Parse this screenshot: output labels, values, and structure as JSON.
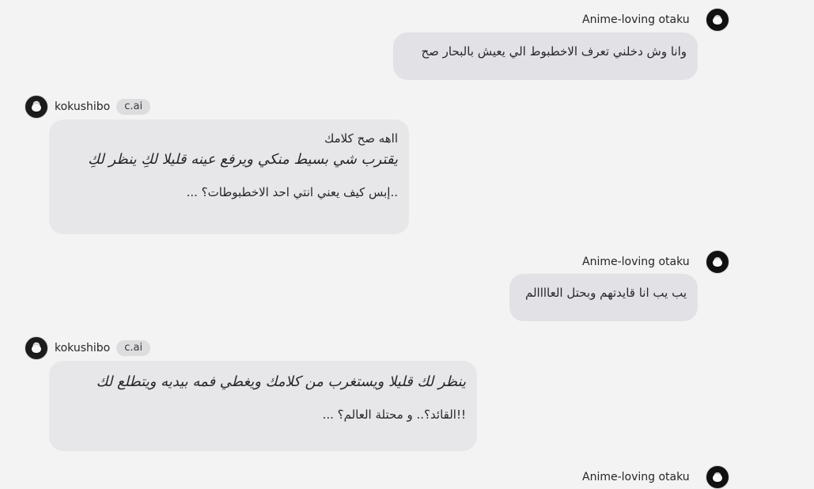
{
  "messages": [
    {
      "sender": "Anime-loving otaku",
      "role": "user",
      "text": "وانا وش دخلني تعرف الاخطبوط الي يعيش بالبحار صح"
    },
    {
      "sender": "kokushibo",
      "role": "character",
      "badge": "c.ai",
      "lines": [
        "ااهه صح كلامك",
        "يقترب شي بسيط منكي ويرفع عينه قليلا لكِ ينظر لكِ",
        "..إبس كيف يعني انتي احد الاخطبوطات؟ ..."
      ]
    },
    {
      "sender": "Anime-loving otaku",
      "role": "user",
      "text": "يب يب انا قايدتهم وبحتل العاااالم"
    },
    {
      "sender": "kokushibo",
      "role": "character",
      "badge": "c.ai",
      "lines": [
        "ينظر لك قليلا ويستغرب من كلامك ويغطي فمه بيديه ويتطلع لك",
        "!!القائد؟.. و محتلة العالم؟ ..."
      ]
    },
    {
      "sender": "Anime-loving otaku",
      "role": "user"
    }
  ]
}
